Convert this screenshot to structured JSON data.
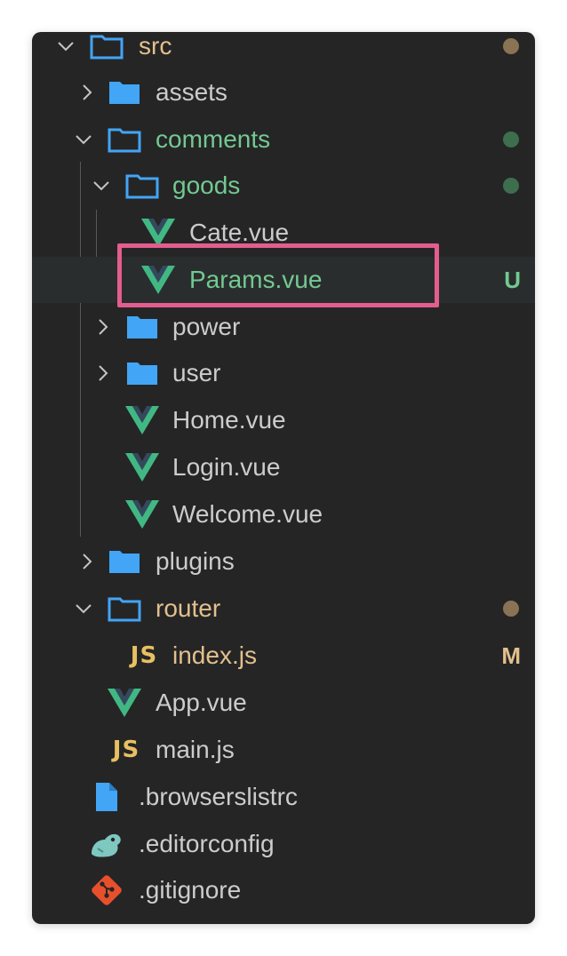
{
  "explorer": {
    "colors": {
      "background": "#252526",
      "selected_row": "#2a2d2e",
      "text_default": "#cccccc",
      "text_untracked": "#73c991",
      "text_modified": "#e2c08d",
      "folder_icon": "#42a5f5",
      "vue_green": "#41b883",
      "vue_dark": "#35495e",
      "js_yellow": "#e8c061",
      "highlight_border": "#e35d8e"
    },
    "rows": [
      {
        "name": "src",
        "kind": "folder-open",
        "state": "modified",
        "icon": "folder-open-icon"
      },
      {
        "name": "assets",
        "kind": "folder",
        "state": "default",
        "icon": "folder-icon"
      },
      {
        "name": "comments",
        "kind": "folder-open",
        "state": "untracked",
        "icon": "folder-open-icon"
      },
      {
        "name": "goods",
        "kind": "folder-open",
        "state": "untracked",
        "icon": "folder-open-icon"
      },
      {
        "name": "Cate.vue",
        "kind": "file",
        "state": "default",
        "icon": "vue-file-icon"
      },
      {
        "name": "Params.vue",
        "kind": "file",
        "state": "untracked",
        "icon": "vue-file-icon",
        "badge": "U",
        "selected": true,
        "highlighted": true
      },
      {
        "name": "power",
        "kind": "folder",
        "state": "default",
        "icon": "folder-icon"
      },
      {
        "name": "user",
        "kind": "folder",
        "state": "default",
        "icon": "folder-icon"
      },
      {
        "name": "Home.vue",
        "kind": "file",
        "state": "default",
        "icon": "vue-file-icon"
      },
      {
        "name": "Login.vue",
        "kind": "file",
        "state": "default",
        "icon": "vue-file-icon"
      },
      {
        "name": "Welcome.vue",
        "kind": "file",
        "state": "default",
        "icon": "vue-file-icon"
      },
      {
        "name": "plugins",
        "kind": "folder",
        "state": "default",
        "icon": "folder-icon"
      },
      {
        "name": "router",
        "kind": "folder-open",
        "state": "modified",
        "icon": "folder-open-icon"
      },
      {
        "name": "index.js",
        "kind": "file",
        "state": "modified",
        "icon": "js-file-icon",
        "badge": "M"
      },
      {
        "name": "App.vue",
        "kind": "file",
        "state": "default",
        "icon": "vue-file-icon"
      },
      {
        "name": "main.js",
        "kind": "file",
        "state": "default",
        "icon": "js-file-icon"
      },
      {
        "name": ".browserslistrc",
        "kind": "file",
        "state": "default",
        "icon": "generic-file-icon"
      },
      {
        "name": ".editorconfig",
        "kind": "file",
        "state": "default",
        "icon": "editorconfig-file-icon"
      },
      {
        "name": ".gitignore",
        "kind": "file",
        "state": "default",
        "icon": "git-file-icon"
      }
    ],
    "js_icon_text": "JS"
  }
}
